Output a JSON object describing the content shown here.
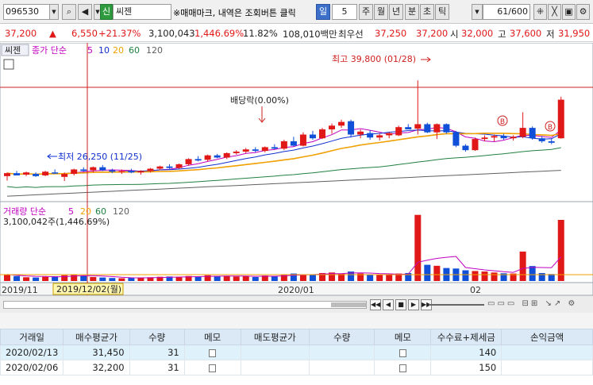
{
  "toolbar": {
    "code": "096530",
    "new_badge": "신",
    "stock_name": "씨젠",
    "hint": "※매매마크, 내역은 조회버튼 클릭",
    "periods": [
      "일",
      "5",
      "주",
      "월",
      "년",
      "분",
      "초",
      "틱"
    ],
    "count": "61",
    "count_total": "/600"
  },
  "quote": {
    "price": "37,200",
    "change_arrow": "▲",
    "change": "6,550",
    "change_pct": "+21.37%",
    "volume": "3,100,043",
    "volume_pct": "1,446.69%",
    "turnover": "11.82%",
    "amount": "108,010백만",
    "pref_label": "최우선",
    "ask": "37,250",
    "bid": "37,200",
    "open_label": "시",
    "open": "32,000",
    "high_label": "고",
    "high": "37,600",
    "low_label": "저",
    "low": "31,950"
  },
  "chart": {
    "price_tab": "씨젠",
    "price_legend": "종가 단순",
    "ma_periods": [
      "5",
      "10",
      "20",
      "60",
      "120"
    ],
    "ma_colors": [
      "#c000c0",
      "#1030d0",
      "#f0a000",
      "#208040",
      "#606060"
    ],
    "volume_legend": "거래량 단순",
    "vol_ma": [
      "5",
      "20",
      "60",
      "120"
    ],
    "volume_info": "3,100,042주(1,446.69%)",
    "high_annot": "최고 39,800 (01/28)",
    "low_annot": "최저 26,250 (11/25)",
    "dividend_annot": "배당락(0.00%)",
    "buy_mark": "B",
    "axis_labels": [
      "2019/11",
      "2020/01",
      "02"
    ],
    "cursor_label": "2019/12/02(월)",
    "up_color": "#e01818",
    "down_color": "#1050d8"
  },
  "chart_data": {
    "type": "candlestick",
    "y_range": [
      24000,
      42500
    ],
    "candles": [
      [
        26900,
        27400,
        26300,
        27300
      ],
      [
        27300,
        27600,
        27000,
        27000
      ],
      [
        27100,
        27500,
        26900,
        27400
      ],
      [
        27200,
        27400,
        26800,
        26900
      ],
      [
        27000,
        27600,
        26900,
        27500
      ],
      [
        27400,
        27800,
        27200,
        27300
      ],
      [
        26800,
        27400,
        26250,
        27200
      ],
      [
        27200,
        27900,
        27000,
        27800
      ],
      [
        27800,
        28100,
        27500,
        27600
      ],
      [
        27700,
        28200,
        27400,
        28100
      ],
      [
        28100,
        28400,
        27600,
        27700
      ],
      [
        27700,
        27900,
        27300,
        27500
      ],
      [
        27500,
        27800,
        27200,
        27600
      ],
      [
        27600,
        27900,
        27300,
        27400
      ],
      [
        27400,
        27700,
        27100,
        27600
      ],
      [
        27600,
        28000,
        27400,
        27900
      ],
      [
        27900,
        28300,
        27700,
        28200
      ],
      [
        28200,
        28500,
        27900,
        28000
      ],
      [
        28000,
        28600,
        27900,
        28500
      ],
      [
        28500,
        29300,
        28300,
        29200
      ],
      [
        29200,
        29600,
        28900,
        29000
      ],
      [
        29100,
        29800,
        28900,
        29700
      ],
      [
        29700,
        29900,
        29300,
        29400
      ],
      [
        29400,
        30100,
        29200,
        30000
      ],
      [
        30000,
        30400,
        29800,
        30200
      ],
      [
        30200,
        30700,
        30000,
        30500
      ],
      [
        30500,
        30800,
        30100,
        30300
      ],
      [
        30300,
        30900,
        30100,
        30800
      ],
      [
        30800,
        31200,
        30500,
        30600
      ],
      [
        30600,
        31800,
        30400,
        31600
      ],
      [
        31600,
        32200,
        30900,
        31000
      ],
      [
        31000,
        32800,
        30900,
        32500
      ],
      [
        32500,
        33000,
        31800,
        32000
      ],
      [
        32000,
        33400,
        31900,
        33200
      ],
      [
        33200,
        34000,
        32600,
        33700
      ],
      [
        33700,
        34500,
        33400,
        34200
      ],
      [
        34300,
        34500,
        32100,
        32500
      ],
      [
        32500,
        33200,
        32000,
        32900
      ],
      [
        32700,
        33100,
        31800,
        32100
      ],
      [
        32100,
        32600,
        31700,
        32400
      ],
      [
        32400,
        32800,
        32000,
        32700
      ],
      [
        32400,
        33700,
        32300,
        33500
      ],
      [
        33500,
        33900,
        33200,
        33200
      ],
      [
        33300,
        39800,
        32500,
        33900
      ],
      [
        33900,
        34100,
        32700,
        32800
      ],
      [
        32800,
        34000,
        31900,
        33900
      ],
      [
        33900,
        34000,
        32600,
        32800
      ],
      [
        32800,
        33000,
        30800,
        31000
      ],
      [
        31000,
        31200,
        30200,
        30400
      ],
      [
        30400,
        32100,
        30300,
        31900
      ],
      [
        31900,
        32400,
        31600,
        32100
      ],
      [
        32100,
        32500,
        31600,
        32300
      ],
      [
        32300,
        32600,
        31800,
        32000
      ],
      [
        32000,
        32400,
        31700,
        32200
      ],
      [
        32200,
        35500,
        32000,
        33400
      ],
      [
        33400,
        33600,
        31800,
        32000
      ],
      [
        32000,
        32300,
        31400,
        31600
      ],
      [
        31600,
        31900,
        31200,
        31400
      ],
      [
        32000,
        37600,
        31950,
        37200
      ]
    ],
    "volumes": [
      260,
      200,
      150,
      140,
      170,
      190,
      230,
      260,
      210,
      160,
      140,
      120,
      110,
      130,
      140,
      150,
      170,
      180,
      150,
      200,
      180,
      230,
      190,
      210,
      180,
      200,
      160,
      220,
      190,
      270,
      300,
      250,
      260,
      320,
      340,
      300,
      380,
      300,
      270,
      240,
      250,
      300,
      320,
      2650,
      650,
      610,
      520,
      500,
      430,
      400,
      380,
      340,
      310,
      300,
      1180,
      600,
      320,
      280,
      2450
    ],
    "vol_range": [
      0,
      2800
    ]
  },
  "bottom": {
    "controls": [
      "◀◀",
      "◀",
      "■",
      "▶",
      "▶▶"
    ]
  },
  "table": {
    "headers": [
      "거래일",
      "매수평균가",
      "수량",
      "메모",
      "매도평균가",
      "수량",
      "메모",
      "수수료+제세금",
      "손익금액"
    ],
    "rows": [
      {
        "date": "2020/02/13",
        "buy_avg": "31,450",
        "qty": "31",
        "sell_avg": "",
        "sell_qty": "",
        "fee": "140",
        "pnl": ""
      },
      {
        "date": "2020/02/06",
        "buy_avg": "32,200",
        "qty": "31",
        "sell_avg": "",
        "sell_qty": "",
        "fee": "150",
        "pnl": ""
      }
    ]
  }
}
